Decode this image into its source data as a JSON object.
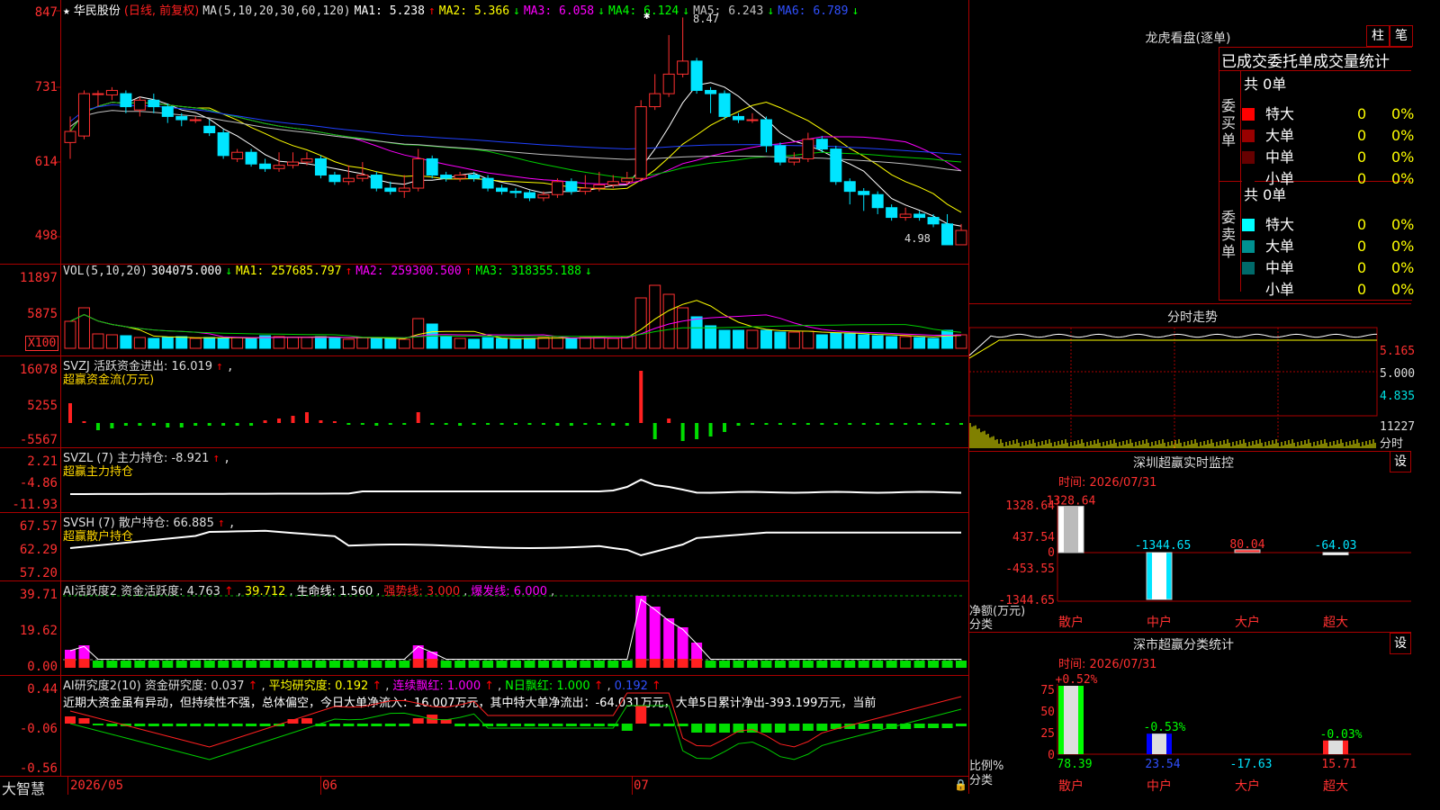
{
  "stock": {
    "star": "★",
    "name": "华民股份",
    "period": "(日线, 前复权)"
  },
  "main_chart": {
    "ma_header": "MA(5,10,20,30,60,120)",
    "ma": [
      {
        "label": "MA1: 5.238",
        "arrow": "↑",
        "color": "#ffffff"
      },
      {
        "label": "MA2: 5.366",
        "arrow": "↓",
        "color": "#ffff00"
      },
      {
        "label": "MA3: 6.058",
        "arrow": "↓",
        "color": "#ff00ff"
      },
      {
        "label": "MA4: 6.124",
        "arrow": "↓",
        "color": "#00ff00"
      },
      {
        "label": "MA5: 6.243",
        "arrow": "↓",
        "color": "#c0c0c0"
      },
      {
        "label": "MA6: 6.789",
        "arrow": "↓",
        "color": "#3050ff"
      }
    ],
    "y_ticks": [
      "847",
      "731",
      "614",
      "498"
    ],
    "high_label": "8.47",
    "low_label": "4.98"
  },
  "vol_panel": {
    "header": "VOL(5,10,20)",
    "value": "304075.000",
    "value_arrow": "↓",
    "ma": [
      {
        "label": "MA1: 257685.797",
        "arrow": "↑",
        "color": "#ffff00"
      },
      {
        "label": "MA2: 259300.500",
        "arrow": "↑",
        "color": "#ff00ff"
      },
      {
        "label": "MA3: 318355.188",
        "arrow": "↓",
        "color": "#00ff00"
      }
    ],
    "y_ticks": [
      "11897",
      "5875",
      "X100"
    ]
  },
  "svzj_panel": {
    "header": "SVZJ  活跃资金进出: 16.019",
    "arrow": "↑",
    "sub": "超赢资金流(万元)",
    "y_ticks": [
      "16078",
      "5255",
      "-5567"
    ]
  },
  "svzl_panel": {
    "header": "SVZL (7) 主力持仓: -8.921",
    "arrow": "↑",
    "sub": "超赢主力持仓",
    "y_ticks": [
      "2.21",
      "-4.86",
      "-11.93"
    ]
  },
  "svsh_panel": {
    "header": "SVSH (7) 散户持仓: 66.885",
    "arrow": "↑",
    "sub": "超赢散户持仓",
    "y_ticks": [
      "67.57",
      "62.29",
      "57.20"
    ]
  },
  "ai_panel": {
    "header": "AI活跃度2 资金活跃度: 4.763",
    "arrow": "↑",
    "v2": "39.712",
    "life": "生命线: 1.560",
    "strong": "强势线: 3.000",
    "burst": "爆发线: 6.000",
    "y_ticks": [
      "39.71",
      "19.62",
      "0.00"
    ]
  },
  "research_panel": {
    "header": "AI研究度2(10) 资金研究度: 0.037",
    "avg": "平均研究度: 0.192",
    "cont": "连续飘红: 1.000",
    "nday": "N日飘红: 1.000",
    "last": "0.192",
    "commentary": "近期大资金虽有异动，但持续性不强，总体偏空，今日大单净流入：16.007万元，其中特大单净流出：-64.031万元，大单5日累计净出-393.199万元，当前",
    "y_ticks": [
      "0.44",
      "-0.06",
      "-0.56"
    ]
  },
  "footer": {
    "brand": "大智慧",
    "dates": [
      "2026/05",
      "06",
      "07"
    ]
  },
  "dragon_panel": {
    "title": "龙虎看盘(逐单)",
    "btn1": "柱",
    "btn2": "笔",
    "header": "已成交委托单成交量统计",
    "buy": {
      "label": "委买单",
      "total": "共 0单",
      "rows": [
        {
          "name": "特大",
          "val": "0",
          "pct": "0%",
          "color": "#ff0000"
        },
        {
          "name": "大单",
          "val": "0",
          "pct": "0%",
          "color": "#990000"
        },
        {
          "name": "中单",
          "val": "0",
          "pct": "0%",
          "color": "#660000"
        },
        {
          "name": "小单",
          "val": "0",
          "pct": "0%",
          "color": "#000000"
        }
      ]
    },
    "sell": {
      "label": "委卖单",
      "total": "共 0单",
      "rows": [
        {
          "name": "特大",
          "val": "0",
          "pct": "0%",
          "color": "#00ffff"
        },
        {
          "name": "大单",
          "val": "0",
          "pct": "0%",
          "color": "#009090"
        },
        {
          "name": "中单",
          "val": "0",
          "pct": "0%",
          "color": "#006a6a"
        },
        {
          "name": "小单",
          "val": "0",
          "pct": "0%",
          "color": "#000000"
        }
      ]
    }
  },
  "intraday": {
    "title": "分时走势",
    "ticks": [
      "5.165",
      "5.000",
      "4.835"
    ],
    "vol_tick": "11227",
    "vol_unit": "分时"
  },
  "sz_monitor": {
    "title": "深圳超赢实时监控",
    "btn": "设",
    "time": "时间: 2026/07/31",
    "y_ticks": [
      "1328.64",
      "437.54",
      "0",
      "-453.55",
      "-1344.65"
    ],
    "ylabel1": "净额(万元)",
    "ylabel2": "分类",
    "bars": [
      {
        "cat": "散户",
        "value": 1328.64,
        "label": "1328.64"
      },
      {
        "cat": "中户",
        "value": -1344.65,
        "label": "-1344.65"
      },
      {
        "cat": "大户",
        "value": 80.04,
        "label": "80.04"
      },
      {
        "cat": "超大",
        "value": -64.03,
        "label": "-64.03"
      }
    ]
  },
  "sz_class": {
    "title": "深市超赢分类统计",
    "btn": "设",
    "time": "时间: 2026/07/31",
    "y_ticks": [
      "75",
      "50",
      "25",
      "0"
    ],
    "ylabel1": "比例%",
    "ylabel2": "分类",
    "bars": [
      {
        "cat": "散户",
        "value": 78.39,
        "label": "78.39",
        "change": "+0.52%"
      },
      {
        "cat": "中户",
        "value": 23.54,
        "label": "23.54",
        "change": "-0.53%"
      },
      {
        "cat": "大户",
        "value": -17.63,
        "label": "-17.63",
        "change": ""
      },
      {
        "cat": "超大",
        "value": 15.71,
        "label": "15.71",
        "change": "-0.03%"
      }
    ]
  },
  "chart_data": {
    "type": "candlestick",
    "ylim": [
      4.8,
      8.6
    ],
    "candles": [
      [
        6.55,
        6.72,
        6.95,
        6.3
      ],
      [
        6.65,
        7.3,
        7.35,
        6.6
      ],
      [
        7.3,
        7.3,
        7.35,
        7.1
      ],
      [
        7.28,
        7.35,
        7.4,
        7.2
      ],
      [
        7.3,
        7.1,
        7.35,
        7.0
      ],
      [
        7.05,
        7.2,
        7.25,
        6.95
      ],
      [
        7.2,
        7.1,
        7.3,
        7.0
      ],
      [
        7.1,
        6.95,
        7.15,
        6.85
      ],
      [
        6.95,
        6.9,
        7.0,
        6.8
      ],
      [
        6.9,
        6.9,
        6.95,
        6.85
      ],
      [
        6.8,
        6.7,
        6.9,
        6.65
      ],
      [
        6.7,
        6.35,
        6.75,
        6.3
      ],
      [
        6.3,
        6.4,
        6.45,
        6.25
      ],
      [
        6.4,
        6.22,
        6.45,
        6.18
      ],
      [
        6.22,
        6.15,
        6.3,
        6.1
      ],
      [
        6.15,
        6.2,
        6.4,
        6.1
      ],
      [
        6.2,
        6.25,
        6.4,
        6.15
      ],
      [
        6.25,
        6.3,
        6.4,
        6.2
      ],
      [
        6.3,
        6.05,
        6.35,
        6.0
      ],
      [
        6.05,
        5.95,
        6.1,
        5.9
      ],
      [
        5.95,
        6.0,
        6.2,
        5.9
      ],
      [
        6.0,
        6.05,
        6.25,
        5.95
      ],
      [
        6.05,
        5.85,
        6.1,
        5.8
      ],
      [
        5.85,
        5.8,
        5.95,
        5.75
      ],
      [
        5.8,
        5.85,
        6.05,
        5.7
      ],
      [
        5.85,
        6.3,
        6.45,
        5.8
      ],
      [
        6.3,
        6.05,
        6.35,
        6.0
      ],
      [
        6.05,
        6.0,
        6.1,
        5.95
      ],
      [
        6.0,
        6.05,
        6.1,
        5.95
      ],
      [
        6.05,
        6.0,
        6.1,
        5.95
      ],
      [
        6.0,
        5.85,
        6.05,
        5.8
      ],
      [
        5.85,
        5.8,
        5.9,
        5.75
      ],
      [
        5.8,
        5.78,
        5.85,
        5.7
      ],
      [
        5.78,
        5.7,
        5.82,
        5.65
      ],
      [
        5.7,
        5.75,
        5.8,
        5.65
      ],
      [
        5.75,
        5.95,
        6.0,
        5.7
      ],
      [
        5.95,
        5.8,
        6.0,
        5.75
      ],
      [
        5.8,
        5.85,
        6.05,
        5.75
      ],
      [
        5.85,
        5.9,
        6.1,
        5.8
      ],
      [
        5.9,
        5.95,
        6.05,
        5.85
      ],
      [
        5.95,
        6.0,
        6.1,
        5.9
      ],
      [
        6.0,
        7.1,
        7.2,
        5.95
      ],
      [
        7.1,
        7.3,
        7.6,
        7.05
      ],
      [
        7.3,
        7.6,
        8.2,
        7.25
      ],
      [
        7.6,
        7.8,
        8.47,
        7.55
      ],
      [
        7.8,
        7.35,
        7.85,
        7.3
      ],
      [
        7.35,
        7.3,
        7.4,
        7.0
      ],
      [
        7.3,
        6.95,
        7.35,
        6.9
      ],
      [
        6.95,
        6.9,
        7.0,
        6.85
      ],
      [
        6.9,
        6.9,
        7.0,
        6.85
      ],
      [
        6.9,
        6.5,
        6.95,
        6.4
      ],
      [
        6.5,
        6.25,
        6.55,
        6.2
      ],
      [
        6.25,
        6.3,
        6.4,
        6.2
      ],
      [
        6.3,
        6.6,
        6.7,
        6.25
      ],
      [
        6.6,
        6.45,
        6.65,
        6.4
      ],
      [
        6.45,
        5.95,
        6.5,
        5.9
      ],
      [
        5.95,
        5.8,
        6.0,
        5.6
      ],
      [
        5.8,
        5.75,
        5.85,
        5.5
      ],
      [
        5.75,
        5.55,
        5.8,
        5.45
      ],
      [
        5.55,
        5.4,
        5.6,
        5.35
      ],
      [
        5.4,
        5.45,
        5.55,
        5.35
      ],
      [
        5.45,
        5.4,
        5.5,
        5.35
      ],
      [
        5.4,
        5.3,
        5.45,
        5.25
      ],
      [
        5.3,
        4.98,
        5.45,
        4.98
      ],
      [
        4.98,
        5.2,
        5.3,
        4.98
      ]
    ]
  }
}
